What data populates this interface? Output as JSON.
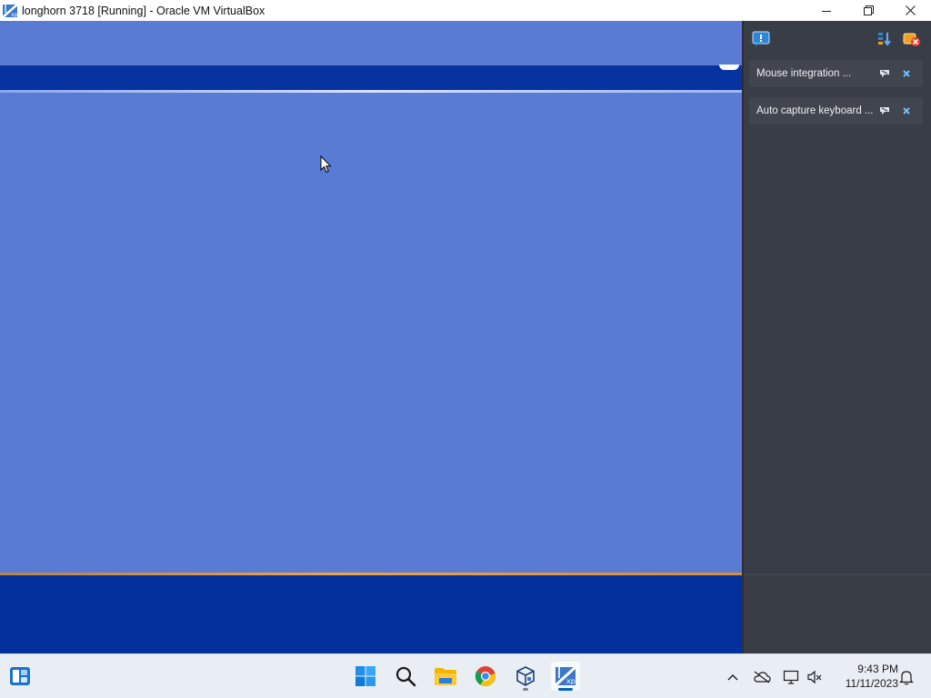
{
  "window": {
    "title": "longhorn 3718 [Running] - Oracle VM VirtualBox"
  },
  "notification_center": {
    "notices": [
      {
        "text": "Mouse integration ..."
      },
      {
        "text": "Auto capture keyboard ..."
      }
    ]
  },
  "taskbar": {
    "clock_time": "9:43 PM",
    "clock_date": "11/11/2023"
  },
  "colors": {
    "vm_desktop": "#5a7bd3",
    "vm_band": "#0733a1",
    "panel_bg": "#393d47",
    "notice_bg": "#41454f",
    "taskbar_bg": "#e9eef4",
    "accent_blue": "#0067c0"
  },
  "icons": {
    "app": "virtualbox-vm-icon",
    "minimize": "minimize-icon",
    "maximize": "restore-icon",
    "close": "close-icon",
    "panel_toolbar": [
      "notification-center-icon",
      "sort-icon",
      "dismiss-all-icon"
    ],
    "notice_actions": [
      "ignore-icon",
      "close-icon"
    ],
    "taskbar": [
      "widgets-icon",
      "start-icon",
      "search-icon",
      "file-explorer-icon",
      "chrome-icon",
      "virtualbox-manager-icon",
      "virtualbox-vm-icon"
    ],
    "tray": [
      "chevron-up-icon",
      "onedrive-icon",
      "network-icon",
      "volume-muted-icon",
      "notification-bell-icon"
    ]
  }
}
